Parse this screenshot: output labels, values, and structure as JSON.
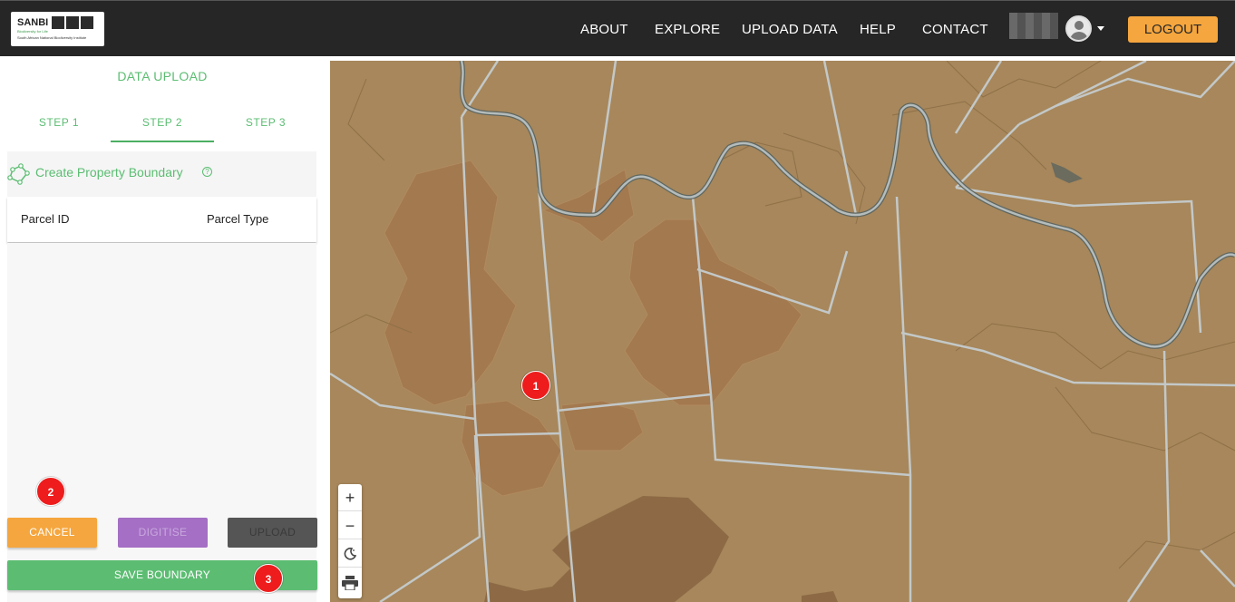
{
  "header": {
    "logo": {
      "wordmark": "SANBI",
      "tagline": "Biodiversity for Life",
      "subtitle": "South African National Biodiversity Institute"
    },
    "nav": [
      "ABOUT",
      "EXPLORE",
      "UPLOAD DATA",
      "HELP",
      "CONTACT"
    ],
    "logout_label": "LOGOUT"
  },
  "sidebar": {
    "title": "DATA UPLOAD",
    "steps": [
      "STEP 1",
      "STEP 2",
      "STEP 3"
    ],
    "active_step": "STEP 2",
    "boundary_title": "Create Property Boundary",
    "help_glyph": "?",
    "table_headers": [
      "Parcel ID",
      "Parcel Type"
    ],
    "buttons": {
      "cancel": "CANCEL",
      "digitise": "DIGITISE",
      "upload": "UPLOAD",
      "save": "SAVE BOUNDARY"
    }
  },
  "map": {
    "controls": {
      "zoom_in": "+",
      "zoom_out": "−",
      "night_icon": "moon-icon",
      "print_icon": "printer-icon"
    }
  },
  "markers": [
    "1",
    "2",
    "3"
  ],
  "colors": {
    "accent_green": "#5cbd72",
    "orange": "#f5a63e",
    "purple": "#a46fc4",
    "navbar": "#262626",
    "marker_red": "#ee1c1c",
    "map_base": "#a7875b"
  }
}
